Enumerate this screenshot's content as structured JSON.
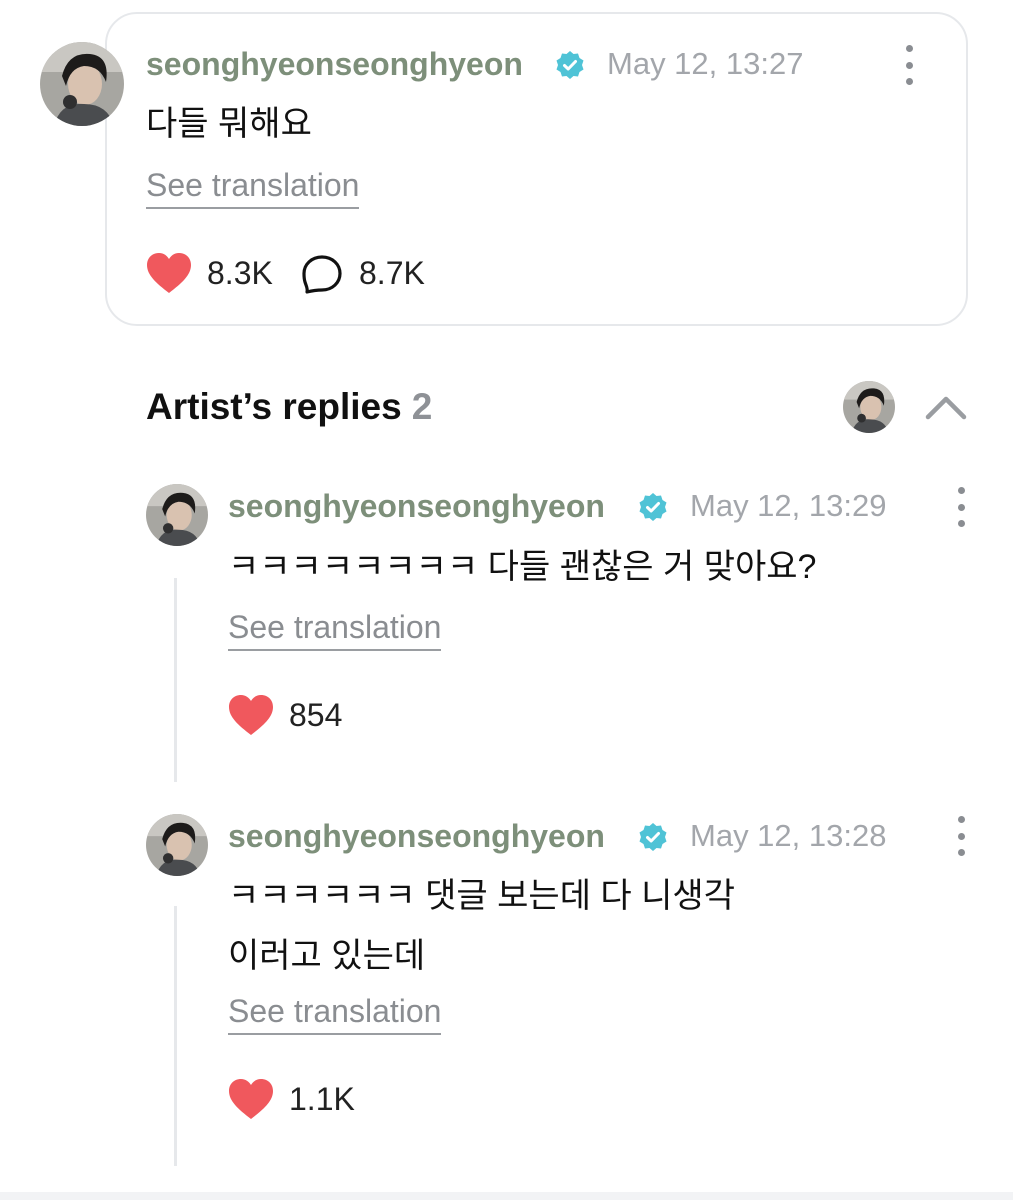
{
  "post": {
    "username": "seonghyeonseonghyeon",
    "timestamp": "May 12, 13:27",
    "text": "다들 뭐해요",
    "see_translation": "See translation",
    "likes": "8.3K",
    "comments": "8.7K"
  },
  "replies_section": {
    "title": "Artist’s replies",
    "count": "2"
  },
  "replies": [
    {
      "username": "seonghyeonseonghyeon",
      "timestamp": "May 12, 13:29",
      "text": "ㅋㅋㅋㅋㅋㅋㅋㅋ 다들 괜찮은 거 맞아요?",
      "see_translation": "See translation",
      "likes": "854"
    },
    {
      "username": "seonghyeonseonghyeon",
      "timestamp": "May 12, 13:28",
      "text": "ㅋㅋㅋㅋㅋㅋ 댓글 보는데 다 니생각\n이러고 있는데",
      "see_translation": "See translation",
      "likes": "1.1K"
    }
  ],
  "colors": {
    "username": "#7d8f7a",
    "verified_badge": "#4fc3d6",
    "heart": "#f0585d",
    "muted_text": "#a3a6ab"
  },
  "icons": {
    "verified": "verified-badge-icon",
    "heart": "heart-icon",
    "comment": "comment-bubble-icon",
    "more": "more-vertical-icon",
    "collapse": "chevron-up-icon"
  }
}
